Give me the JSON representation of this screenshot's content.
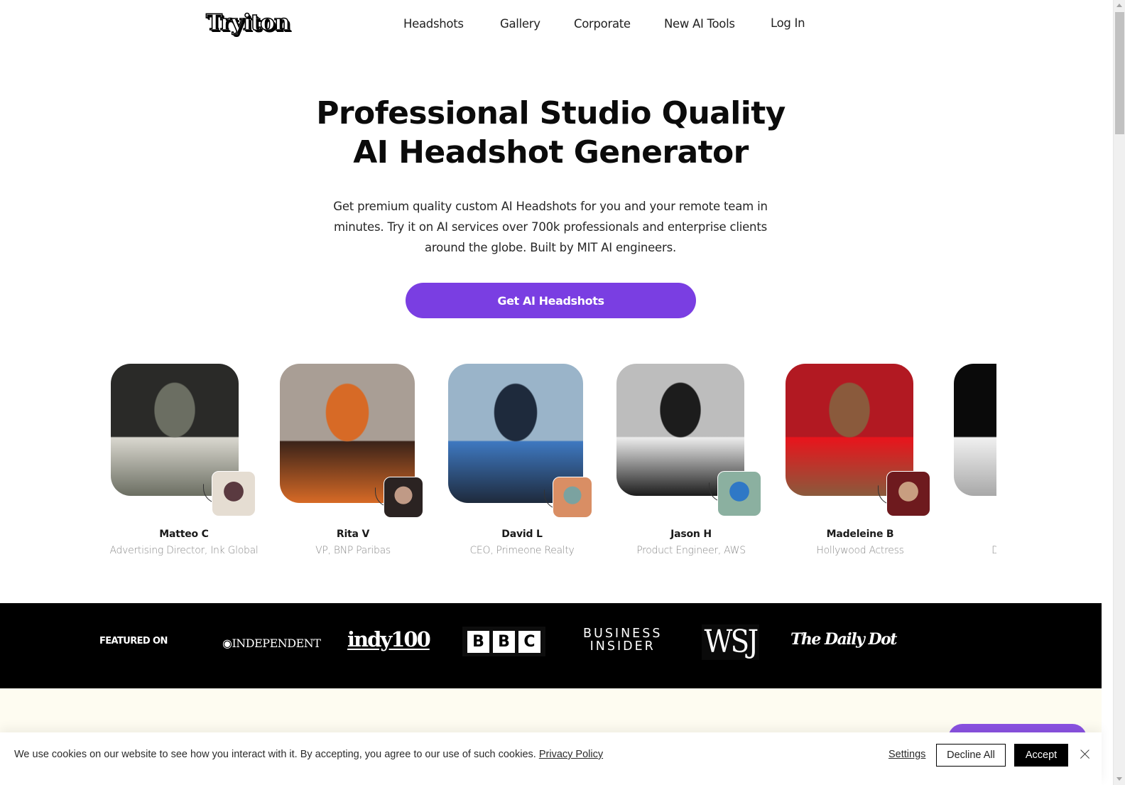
{
  "header": {
    "logo_text": "Tryiton",
    "nav": [
      {
        "label": "Headshots"
      },
      {
        "label": "Gallery"
      },
      {
        "label": "Corporate"
      },
      {
        "label": "New AI Tools"
      },
      {
        "label": "Log In"
      }
    ]
  },
  "hero": {
    "title_line1": "Professional Studio Quality",
    "title_line2": "AI Headshot Generator",
    "subtitle": "Get premium quality custom AI Headshots for you and your remote team in minutes. Try it on AI services over 700k professionals and enterprise clients around the globe. Built by MIT AI engineers.",
    "cta_label": "Get AI Headshots",
    "accent_color": "#7a3ee2"
  },
  "testimonials": [
    {
      "name": "Matteo C",
      "role": "Advertising Director, Ink Global",
      "photo_colors": [
        "#2a2a28",
        "#6b6e62",
        "#d9d7cf"
      ],
      "thumb_colors": [
        "#e5ddd2",
        "#5a3a40"
      ]
    },
    {
      "name": "Rita V",
      "role": "VP, BNP Paribas",
      "photo_colors": [
        "#a99e95",
        "#d76a26",
        "#3b2319"
      ],
      "thumb_colors": [
        "#2b2322",
        "#c09a86"
      ]
    },
    {
      "name": "David L",
      "role": "CEO, Primeone Realty",
      "photo_colors": [
        "#9ab4c9",
        "#1e2a3c",
        "#3e78c0"
      ],
      "thumb_colors": [
        "#d98e64",
        "#7ba2a0"
      ]
    },
    {
      "name": "Jason H",
      "role": "Product Engineer, AWS",
      "photo_colors": [
        "#bdbdbd",
        "#1c1c1c",
        "#ececec"
      ],
      "thumb_colors": [
        "#8bb0a0",
        "#2f78c6"
      ]
    },
    {
      "name": "Madeleine B",
      "role": "Hollywood Actress",
      "photo_colors": [
        "#b21922",
        "#8a5a3c",
        "#e8141c"
      ],
      "thumb_colors": [
        "#6e1a1e",
        "#c89e80"
      ]
    },
    {
      "name": "",
      "role": "Director",
      "photo_colors": [
        "#0a0a0a",
        "#a8a8a8",
        "#f0f0f0"
      ],
      "thumb_colors": []
    }
  ],
  "featured": {
    "label": "FEATURED ON",
    "logos": {
      "independent": "INDEPENDENT",
      "indy100": "indy100",
      "bbc": [
        "B",
        "B",
        "C"
      ],
      "business_insider_line1": "BUSINESS",
      "business_insider_line2": "INSIDER",
      "wsj": "WSJ",
      "daily_dot": "The Daily Dot"
    }
  },
  "cookie_banner": {
    "message": "We use cookies on our website to see how you interact with it. By accepting, you agree to our use of such cookies.",
    "privacy_link": "Privacy Policy",
    "settings_label": "Settings",
    "decline_label": "Decline All",
    "accept_label": "Accept"
  }
}
